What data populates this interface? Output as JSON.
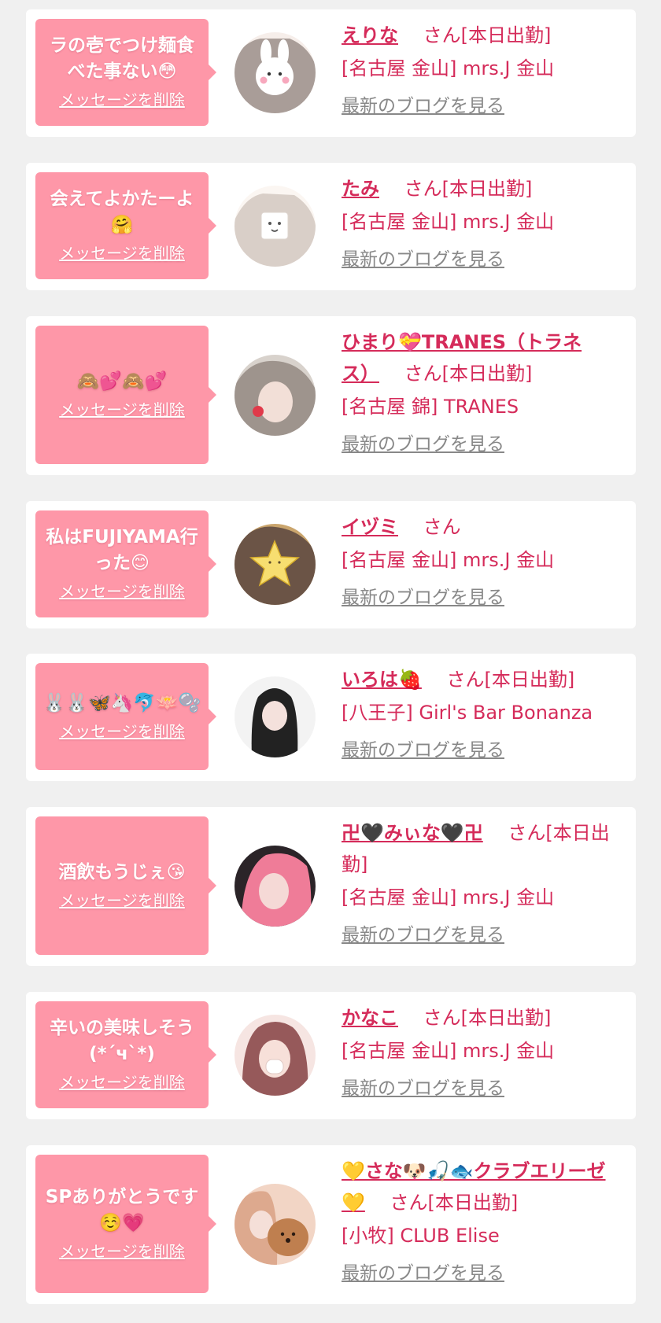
{
  "theme": {
    "page_background": "#f0f0f0",
    "card_background": "#ffffff",
    "bubble_color": "#fe97a8",
    "accent_text": "#d52b5a",
    "muted_text": "#888888"
  },
  "common": {
    "delete_label": "メッセージを削除",
    "blog_label": "最新のブログを見る"
  },
  "messages": [
    {
      "message": "ラの壱でつけ麺食べた事ない😳",
      "name": "えりな",
      "suffix": "さん[本日出勤]",
      "shop": "[名古屋 金山] mrs.J 金山",
      "avatar_icon": "bunny-sticker-avatar",
      "avatar_colors": [
        "#f6eeea",
        "#6a5b53"
      ]
    },
    {
      "message": "会えてよかたーよ🤗",
      "name": "たみ",
      "suffix": "さん[本日出勤]",
      "shop": "[名古屋 金山] mrs.J 金山",
      "avatar_icon": "cube-mask-avatar",
      "avatar_colors": [
        "#fbf6f2",
        "#b8a89d"
      ]
    },
    {
      "message": "🙈💕🙈💕",
      "name": "ひまり💝TRANES（トラネス）",
      "suffix": "さん[本日出勤]",
      "shop": "[名古屋 錦] TRANES",
      "avatar_icon": "photo-avatar",
      "avatar_colors": [
        "#d8d2cc",
        "#6f6059"
      ]
    },
    {
      "message": "私はFUJIYAMA行った😊",
      "name": "イヅミ",
      "suffix": "さん",
      "shop": "[名古屋 金山] mrs.J 金山",
      "avatar_icon": "star-sticker-avatar",
      "avatar_colors": [
        "#caa56d",
        "#4b3a39"
      ]
    },
    {
      "message": "🐰🐰🦋🦄🐬🪷🫧",
      "name": "いろは🍓",
      "suffix": "さん[本日出勤]",
      "shop": "[八王子] Girl's Bar Bonanza",
      "avatar_icon": "photo-avatar",
      "avatar_colors": [
        "#f3f3f3",
        "#222222"
      ]
    },
    {
      "message": "酒飲もうじぇ😘",
      "name": "卍🖤みぃな🖤卍",
      "suffix": "さん[本日出勤]",
      "shop": "[名古屋 金山] mrs.J 金山",
      "avatar_icon": "photo-avatar",
      "avatar_colors": [
        "#ef7c98",
        "#2b2428"
      ]
    },
    {
      "message": "辛いの美味しそう(*´ч`*)",
      "name": "かなこ",
      "suffix": "さん[本日出勤]",
      "shop": "[名古屋 金山] mrs.J 金山",
      "avatar_icon": "mask-sticker-avatar",
      "avatar_colors": [
        "#f6e5e2",
        "#96595a"
      ]
    },
    {
      "message": "SPありがとうです☺️💗",
      "name": "💛さな🐶🎣🐟クラブエリーゼ💛",
      "suffix": "さん[本日出勤]",
      "shop": "[小牧] CLUB Elise",
      "avatar_icon": "dog-photo-avatar",
      "avatar_colors": [
        "#f2d5c5",
        "#bf7f4f"
      ]
    }
  ]
}
